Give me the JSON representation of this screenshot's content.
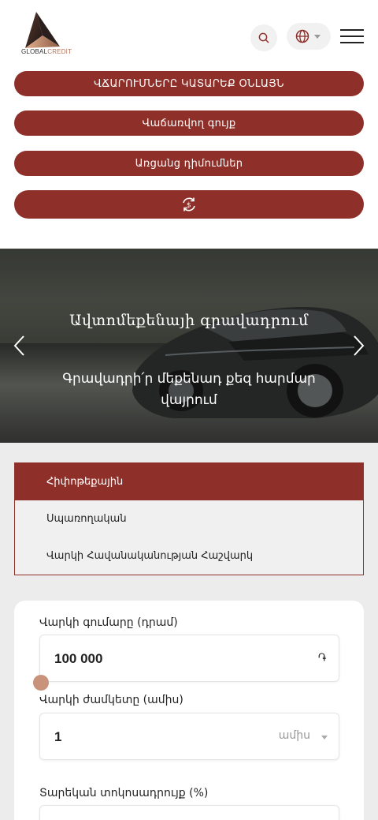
{
  "header": {
    "logo_text_global": "GLOBAL",
    "logo_text_credit": "CREDIT",
    "search_icon": "search-icon",
    "language_icon": "globe-icon",
    "menu_icon": "hamburger-menu-icon"
  },
  "actions": [
    {
      "label": "ՎՃԱՐՈՒՄՆԵՐԸ ԿԱՏԱՐԵՔ ՕՆԼԱՅՆ"
    },
    {
      "label": "Վաճառվող գույք"
    },
    {
      "label": "Առցանց դիմումներ"
    },
    {
      "icon": "currency-exchange-icon"
    }
  ],
  "hero": {
    "title": "Ավտոմեքենայի գրավադրում",
    "subtitle": "Գրավադրի՛ր մեքենադ քեզ հարմար վայրում",
    "prev_icon": "chevron-left-icon",
    "next_icon": "chevron-right-icon"
  },
  "tabs": [
    {
      "label": "Հիփոթեքային",
      "active": true
    },
    {
      "label": "Սպառողական",
      "active": false
    },
    {
      "label": "Վարկի Հավանականության Հաշվարկ",
      "active": false
    }
  ],
  "calculator": {
    "amount_label": "Վարկի գումարը (դրամ)",
    "amount_value": "100 000",
    "amount_unit": "֏",
    "amount_slider_fraction": 0,
    "term_label": "Վարկի ժամկետը (ամիս)",
    "term_value": "1",
    "term_unit": "ամիս",
    "rate_label": "Տարեկան տոկոսադրույք (%)"
  },
  "colors": {
    "brand": "#8e3029",
    "slider_thumb": "#c9927a",
    "section_bg": "#ececec"
  }
}
